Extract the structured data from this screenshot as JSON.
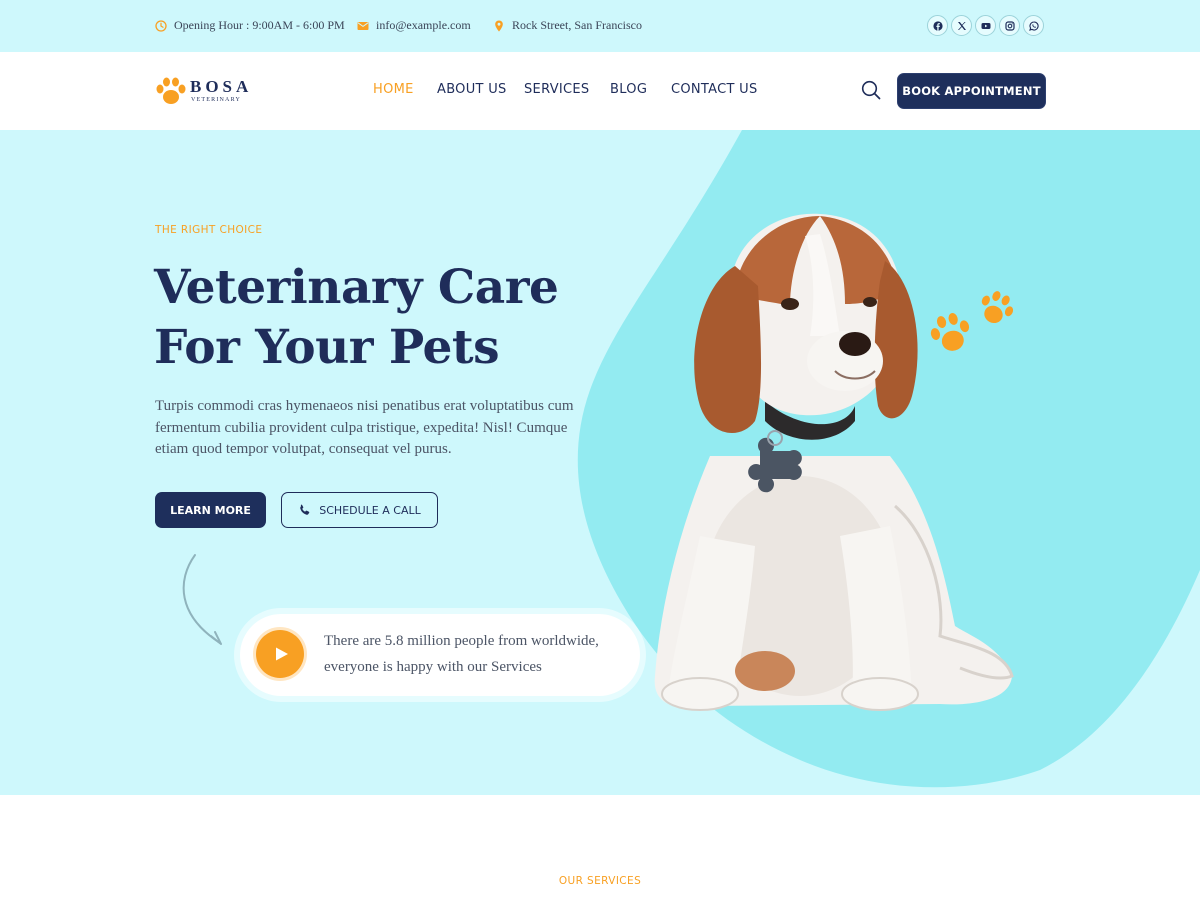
{
  "topbar": {
    "opening_hours": "Opening Hour : 9:00AM - 6:00 PM",
    "email": "info@example.com",
    "address": "Rock Street, San Francisco",
    "social": [
      "facebook-icon",
      "x-twitter-icon",
      "youtube-icon",
      "instagram-icon",
      "whatsapp-icon"
    ]
  },
  "header": {
    "logo_word": "BOSA",
    "logo_sub": "VETERINARY",
    "nav": [
      {
        "label": "HOME",
        "active": true
      },
      {
        "label": "ABOUT US",
        "active": false
      },
      {
        "label": "SERVICES",
        "active": false
      },
      {
        "label": "BLOG",
        "active": false
      },
      {
        "label": "CONTACT US",
        "active": false
      }
    ],
    "cta_label": "BOOK APPOINTMENT"
  },
  "hero": {
    "eyebrow": "THE RIGHT CHOICE",
    "title_line1": "Veterinary Care",
    "title_line2": "For Your Pets",
    "description": "Turpis commodi cras hymenaeos nisi penatibus erat voluptatibus cum fermentum cubilia provident culpa tristique, expedita! Nisl! Cumque etiam quod tempor volutpat, consequat vel purus.",
    "learn_more_label": "LEARN MORE",
    "schedule_label": "SCHEDULE A CALL",
    "video_text_line1": "There are 5.8 million people from worldwide,",
    "video_text_line2": "everyone is happy with our Services"
  },
  "services": {
    "eyebrow": "OUR SERVICES"
  },
  "colors": {
    "navy": "#1e2f5c",
    "accent": "#f8a023",
    "hero_bg": "#cef8fc",
    "hero_blob": "#93ebf1"
  }
}
